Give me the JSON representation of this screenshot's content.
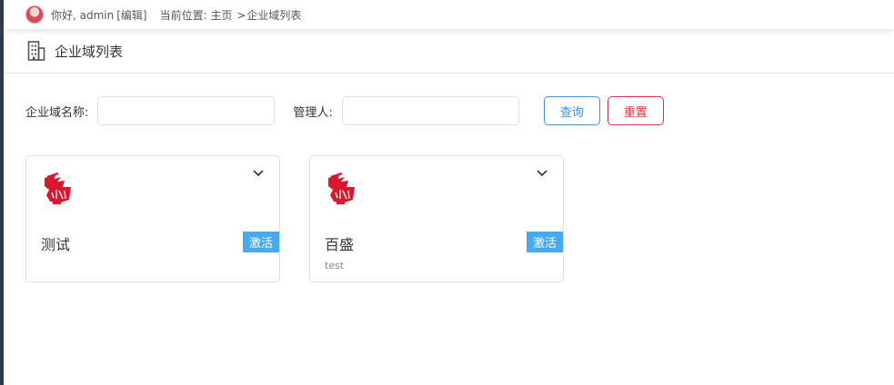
{
  "topbar": {
    "greeting": "你好, admin",
    "edit_link": "[编辑]",
    "location_label": "当前位置:",
    "breadcrumb_home": "主页",
    "breadcrumb_sep": ">",
    "breadcrumb_current": "企业域列表"
  },
  "page": {
    "title": "企业域列表",
    "icon": "building-icon"
  },
  "search": {
    "name_label": "企业域名称:",
    "name_value": "",
    "manager_label": "管理人:",
    "manager_value": "",
    "query_button": "查询",
    "reset_button": "重置"
  },
  "cards": [
    {
      "name": "测试",
      "description": "",
      "status": "激活",
      "icon": "tianhu-logo-icon"
    },
    {
      "name": "百盛",
      "description": "test",
      "status": "激活",
      "icon": "tianhu-logo-icon"
    }
  ],
  "colors": {
    "sidebar": "#2f3a4e",
    "primary": "#3a8ee6",
    "danger": "#d9303f",
    "badge": "#49a9f0",
    "logo_red": "#d9182d"
  }
}
